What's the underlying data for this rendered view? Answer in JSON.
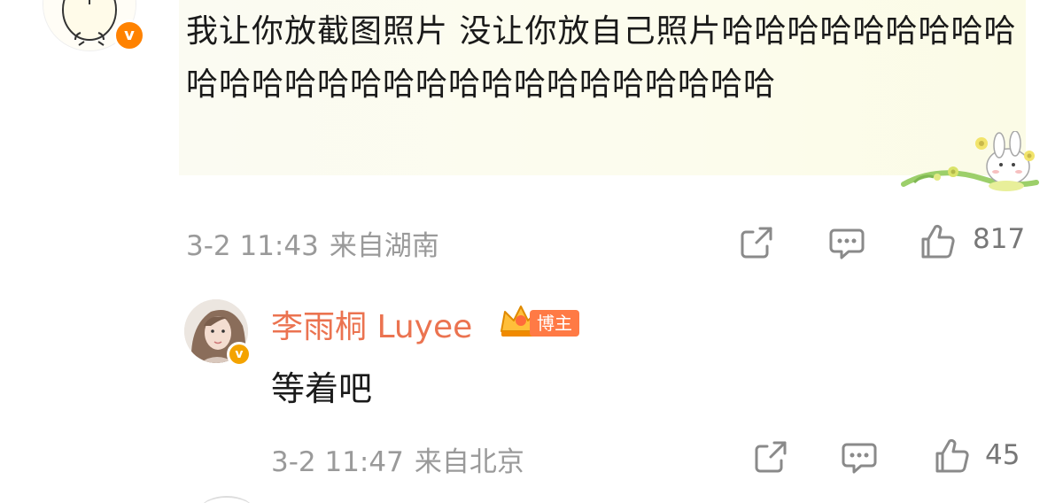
{
  "comment": {
    "text": "我让你放截图照片 没让你放自己照片哈哈哈哈哈哈哈哈哈哈哈哈哈哈哈哈哈哈哈哈哈哈哈哈哈哈哈",
    "date": "3-2 11:43",
    "location": "来自湖南",
    "like_count": "817",
    "verified_badge": "v"
  },
  "reply": {
    "author": "李雨桐 Luyee",
    "badge_label": "博主",
    "text": "等着吧",
    "date": "3-2 11:47",
    "location": "来自北京",
    "like_count": "45",
    "verified_badge": "v"
  },
  "icons": {
    "share": "share-icon",
    "comment": "comment-icon",
    "like": "thumbs-up-icon",
    "verified": "verified-badge-icon",
    "crown": "crown-icon"
  },
  "colors": {
    "name_accent": "#eb7350",
    "verified_orange": "#ff8200",
    "meta_gray": "#9a9a9a",
    "bubble_bg": "#fbfbf0"
  }
}
